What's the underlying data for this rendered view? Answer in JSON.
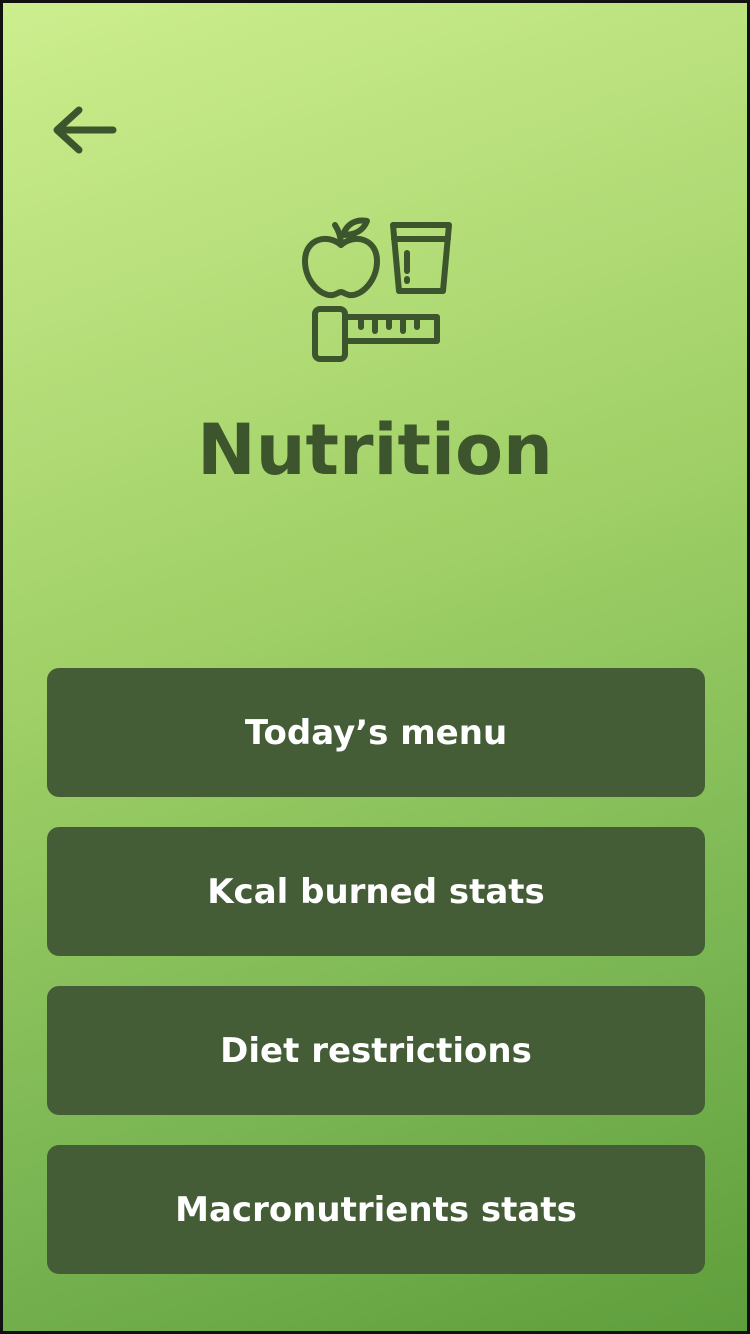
{
  "colors": {
    "accent": "#3d552d",
    "button_bg": "#445d36",
    "button_text": "#ffffff",
    "gradient_top": "#cdee8e",
    "gradient_bottom": "#5f9e3c"
  },
  "header": {
    "back_icon": "arrow-left-icon"
  },
  "hero": {
    "icon": "nutrition-icon",
    "title": "Nutrition"
  },
  "menu": {
    "items": [
      {
        "label": "Today’s menu"
      },
      {
        "label": "Kcal burned stats"
      },
      {
        "label": "Diet restrictions"
      },
      {
        "label": "Macronutrients stats"
      }
    ]
  }
}
